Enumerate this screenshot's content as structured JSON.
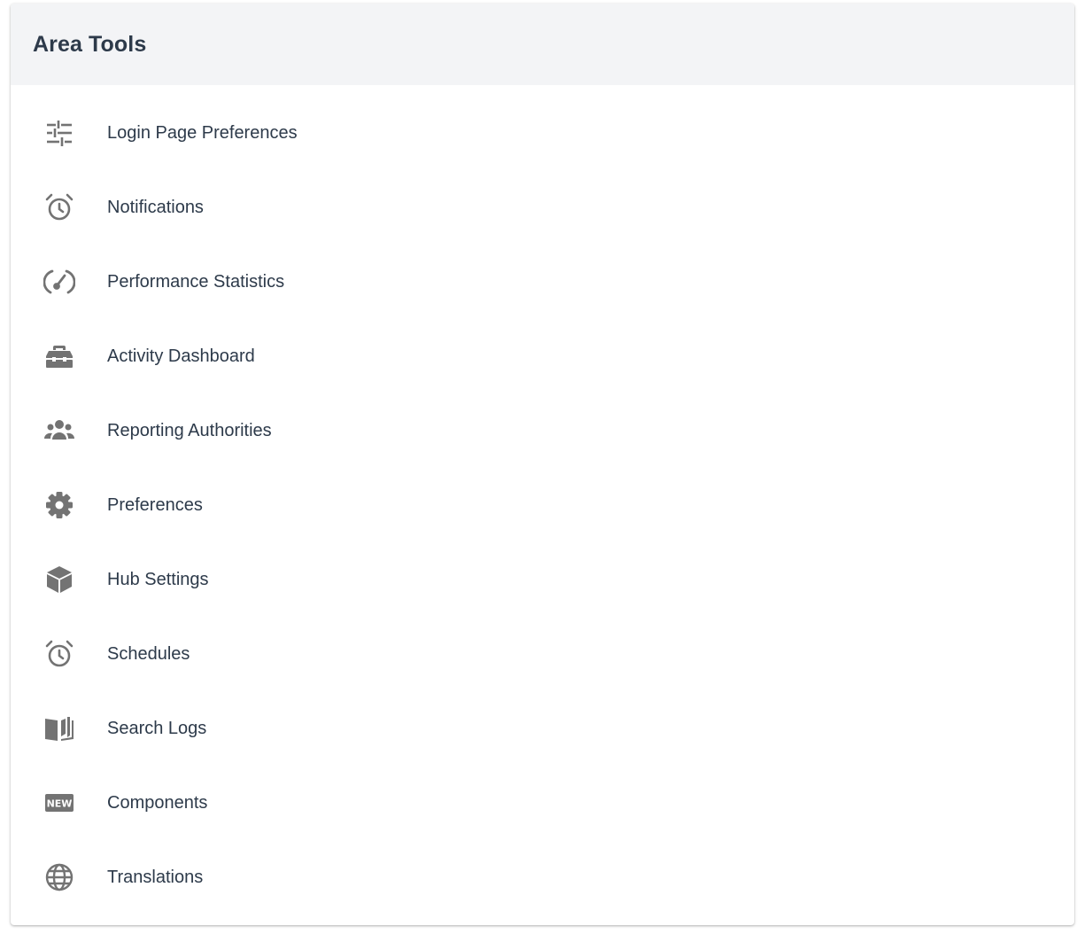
{
  "panel": {
    "title": "Area Tools",
    "icon_color": "#737373",
    "text_color": "#2d3a4a",
    "header_bg": "#f3f4f6"
  },
  "tools": [
    {
      "label": "Login Page Preferences",
      "icon": "sliders-icon"
    },
    {
      "label": "Notifications",
      "icon": "alarm-clock-icon"
    },
    {
      "label": "Performance Statistics",
      "icon": "speedometer-icon"
    },
    {
      "label": "Activity Dashboard",
      "icon": "toolbox-icon"
    },
    {
      "label": "Reporting Authorities",
      "icon": "users-group-icon"
    },
    {
      "label": "Preferences",
      "icon": "gear-icon"
    },
    {
      "label": "Hub Settings",
      "icon": "cube-icon"
    },
    {
      "label": "Schedules",
      "icon": "alarm-clock-icon"
    },
    {
      "label": "Search Logs",
      "icon": "open-book-icon"
    },
    {
      "label": "Components",
      "icon": "new-badge-icon"
    },
    {
      "label": "Translations",
      "icon": "globe-icon"
    }
  ]
}
